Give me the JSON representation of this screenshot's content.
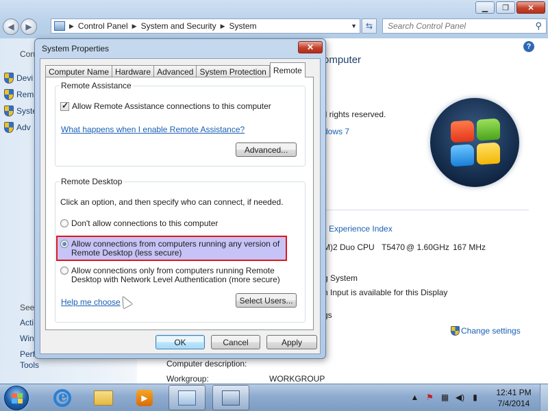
{
  "colors": {
    "accent": "#1a5fb4",
    "highlight_fill": "#c6c3f6",
    "highlight_border": "#e0141c",
    "close_red": "#c6412b"
  },
  "explorer": {
    "address_crumbs": [
      "Control Panel",
      "System and Security",
      "System"
    ],
    "search_placeholder": "Search Control Panel",
    "help_label": "?",
    "sidebar": {
      "header_partial": "Con",
      "items": [
        "Devi",
        "Remo",
        "Syste",
        "Adv"
      ],
      "see_also_partial": "See",
      "bottom_items": [
        "Acti",
        "Win",
        "Perf",
        "Tools"
      ]
    },
    "content": {
      "title_partial": "omputer",
      "rights_partial": "ll rights reserved.",
      "edition_partial": "dows 7",
      "wei_partial": "Experience Index",
      "processor_partial": "M)2 Duo CPU",
      "processor_model": "T5470",
      "processor_speed_1": "@ 1.60GHz",
      "processor_speed_2": "167 MHz",
      "system_type_partial": "g System",
      "pen_partial": "h Input is available for this Display",
      "settings_partial": "gs",
      "change_settings": "Change settings",
      "computer_description_label": "Computer description:",
      "workgroup_label": "Workgroup:",
      "workgroup_value": "WORKGROUP"
    }
  },
  "dialog": {
    "title": "System Properties",
    "close_label": "✕",
    "tabs": [
      "Computer Name",
      "Hardware",
      "Advanced",
      "System Protection",
      "Remote"
    ],
    "active_tab": "Remote",
    "remote_assistance": {
      "group_label": "Remote Assistance",
      "checkbox_label": "Allow Remote Assistance connections to this computer",
      "checkbox_checked": true,
      "help_link": "What happens when I enable Remote Assistance?",
      "advanced_button": "Advanced..."
    },
    "remote_desktop": {
      "group_label": "Remote Desktop",
      "instructions": "Click an option, and then specify who can connect, if needed.",
      "options": [
        {
          "line1": "Don't allow connections to this computer",
          "line2": "",
          "selected": false
        },
        {
          "line1": "Allow connections from computers running any version of",
          "line2": "Remote Desktop (less secure)",
          "selected": true
        },
        {
          "line1": "Allow connections only from computers running Remote",
          "line2": "Desktop with Network Level Authentication (more secure)",
          "selected": false
        }
      ],
      "help_link": "Help me choose",
      "select_users_button": "Select Users..."
    },
    "buttons": {
      "ok": "OK",
      "cancel": "Cancel",
      "apply": "Apply"
    }
  },
  "taskbar": {
    "pinned": [
      "start-orb",
      "internet-explorer-icon",
      "windows-explorer-icon",
      "media-player-icon",
      "control-panel-icon",
      "system-properties-icon"
    ],
    "clock_time": "12:41 PM",
    "clock_date": "7/4/2014"
  }
}
